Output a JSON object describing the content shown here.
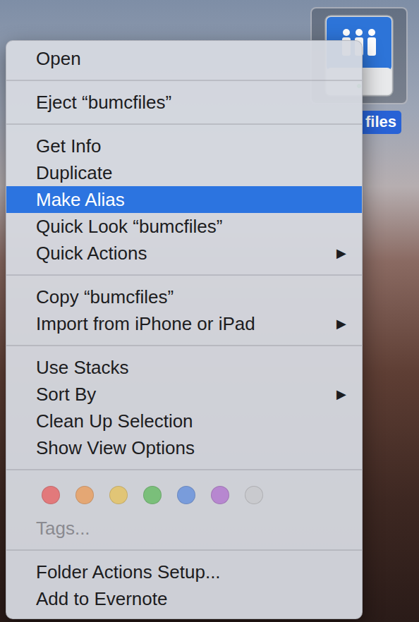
{
  "desktop_item": {
    "label": "files",
    "selected": true
  },
  "menu": {
    "groups": [
      {
        "kind": "items",
        "items": [
          {
            "label": "Open",
            "selected": false,
            "submenu": false
          }
        ]
      },
      {
        "kind": "items",
        "items": [
          {
            "label": "Eject “bumcfiles”",
            "selected": false,
            "submenu": false
          }
        ]
      },
      {
        "kind": "items",
        "items": [
          {
            "label": "Get Info",
            "selected": false,
            "submenu": false
          },
          {
            "label": "Duplicate",
            "selected": false,
            "submenu": false
          },
          {
            "label": "Make Alias",
            "selected": true,
            "submenu": false
          },
          {
            "label": "Quick Look “bumcfiles”",
            "selected": false,
            "submenu": false
          },
          {
            "label": "Quick Actions",
            "selected": false,
            "submenu": true
          }
        ]
      },
      {
        "kind": "items",
        "items": [
          {
            "label": "Copy “bumcfiles”",
            "selected": false,
            "submenu": false
          },
          {
            "label": "Import from iPhone or iPad",
            "selected": false,
            "submenu": true
          }
        ]
      },
      {
        "kind": "items",
        "items": [
          {
            "label": "Use Stacks",
            "selected": false,
            "submenu": false
          },
          {
            "label": "Sort By",
            "selected": false,
            "submenu": true
          },
          {
            "label": "Clean Up Selection",
            "selected": false,
            "submenu": false
          },
          {
            "label": "Show View Options",
            "selected": false,
            "submenu": false
          }
        ]
      },
      {
        "kind": "tags",
        "tags": [
          {
            "color": "#e66a6c"
          },
          {
            "color": "#e9a064"
          },
          {
            "color": "#e5c466"
          },
          {
            "color": "#6cbd6a"
          },
          {
            "color": "#6b93dd"
          },
          {
            "color": "#b47bcf"
          },
          {
            "color": "#c9c9cd"
          }
        ],
        "label": "Tags...",
        "disabled": true
      },
      {
        "kind": "items",
        "items": [
          {
            "label": "Folder Actions Setup...",
            "selected": false,
            "submenu": false
          },
          {
            "label": "Add to Evernote",
            "selected": false,
            "submenu": false
          }
        ]
      }
    ],
    "submenu_arrow": "▶"
  }
}
